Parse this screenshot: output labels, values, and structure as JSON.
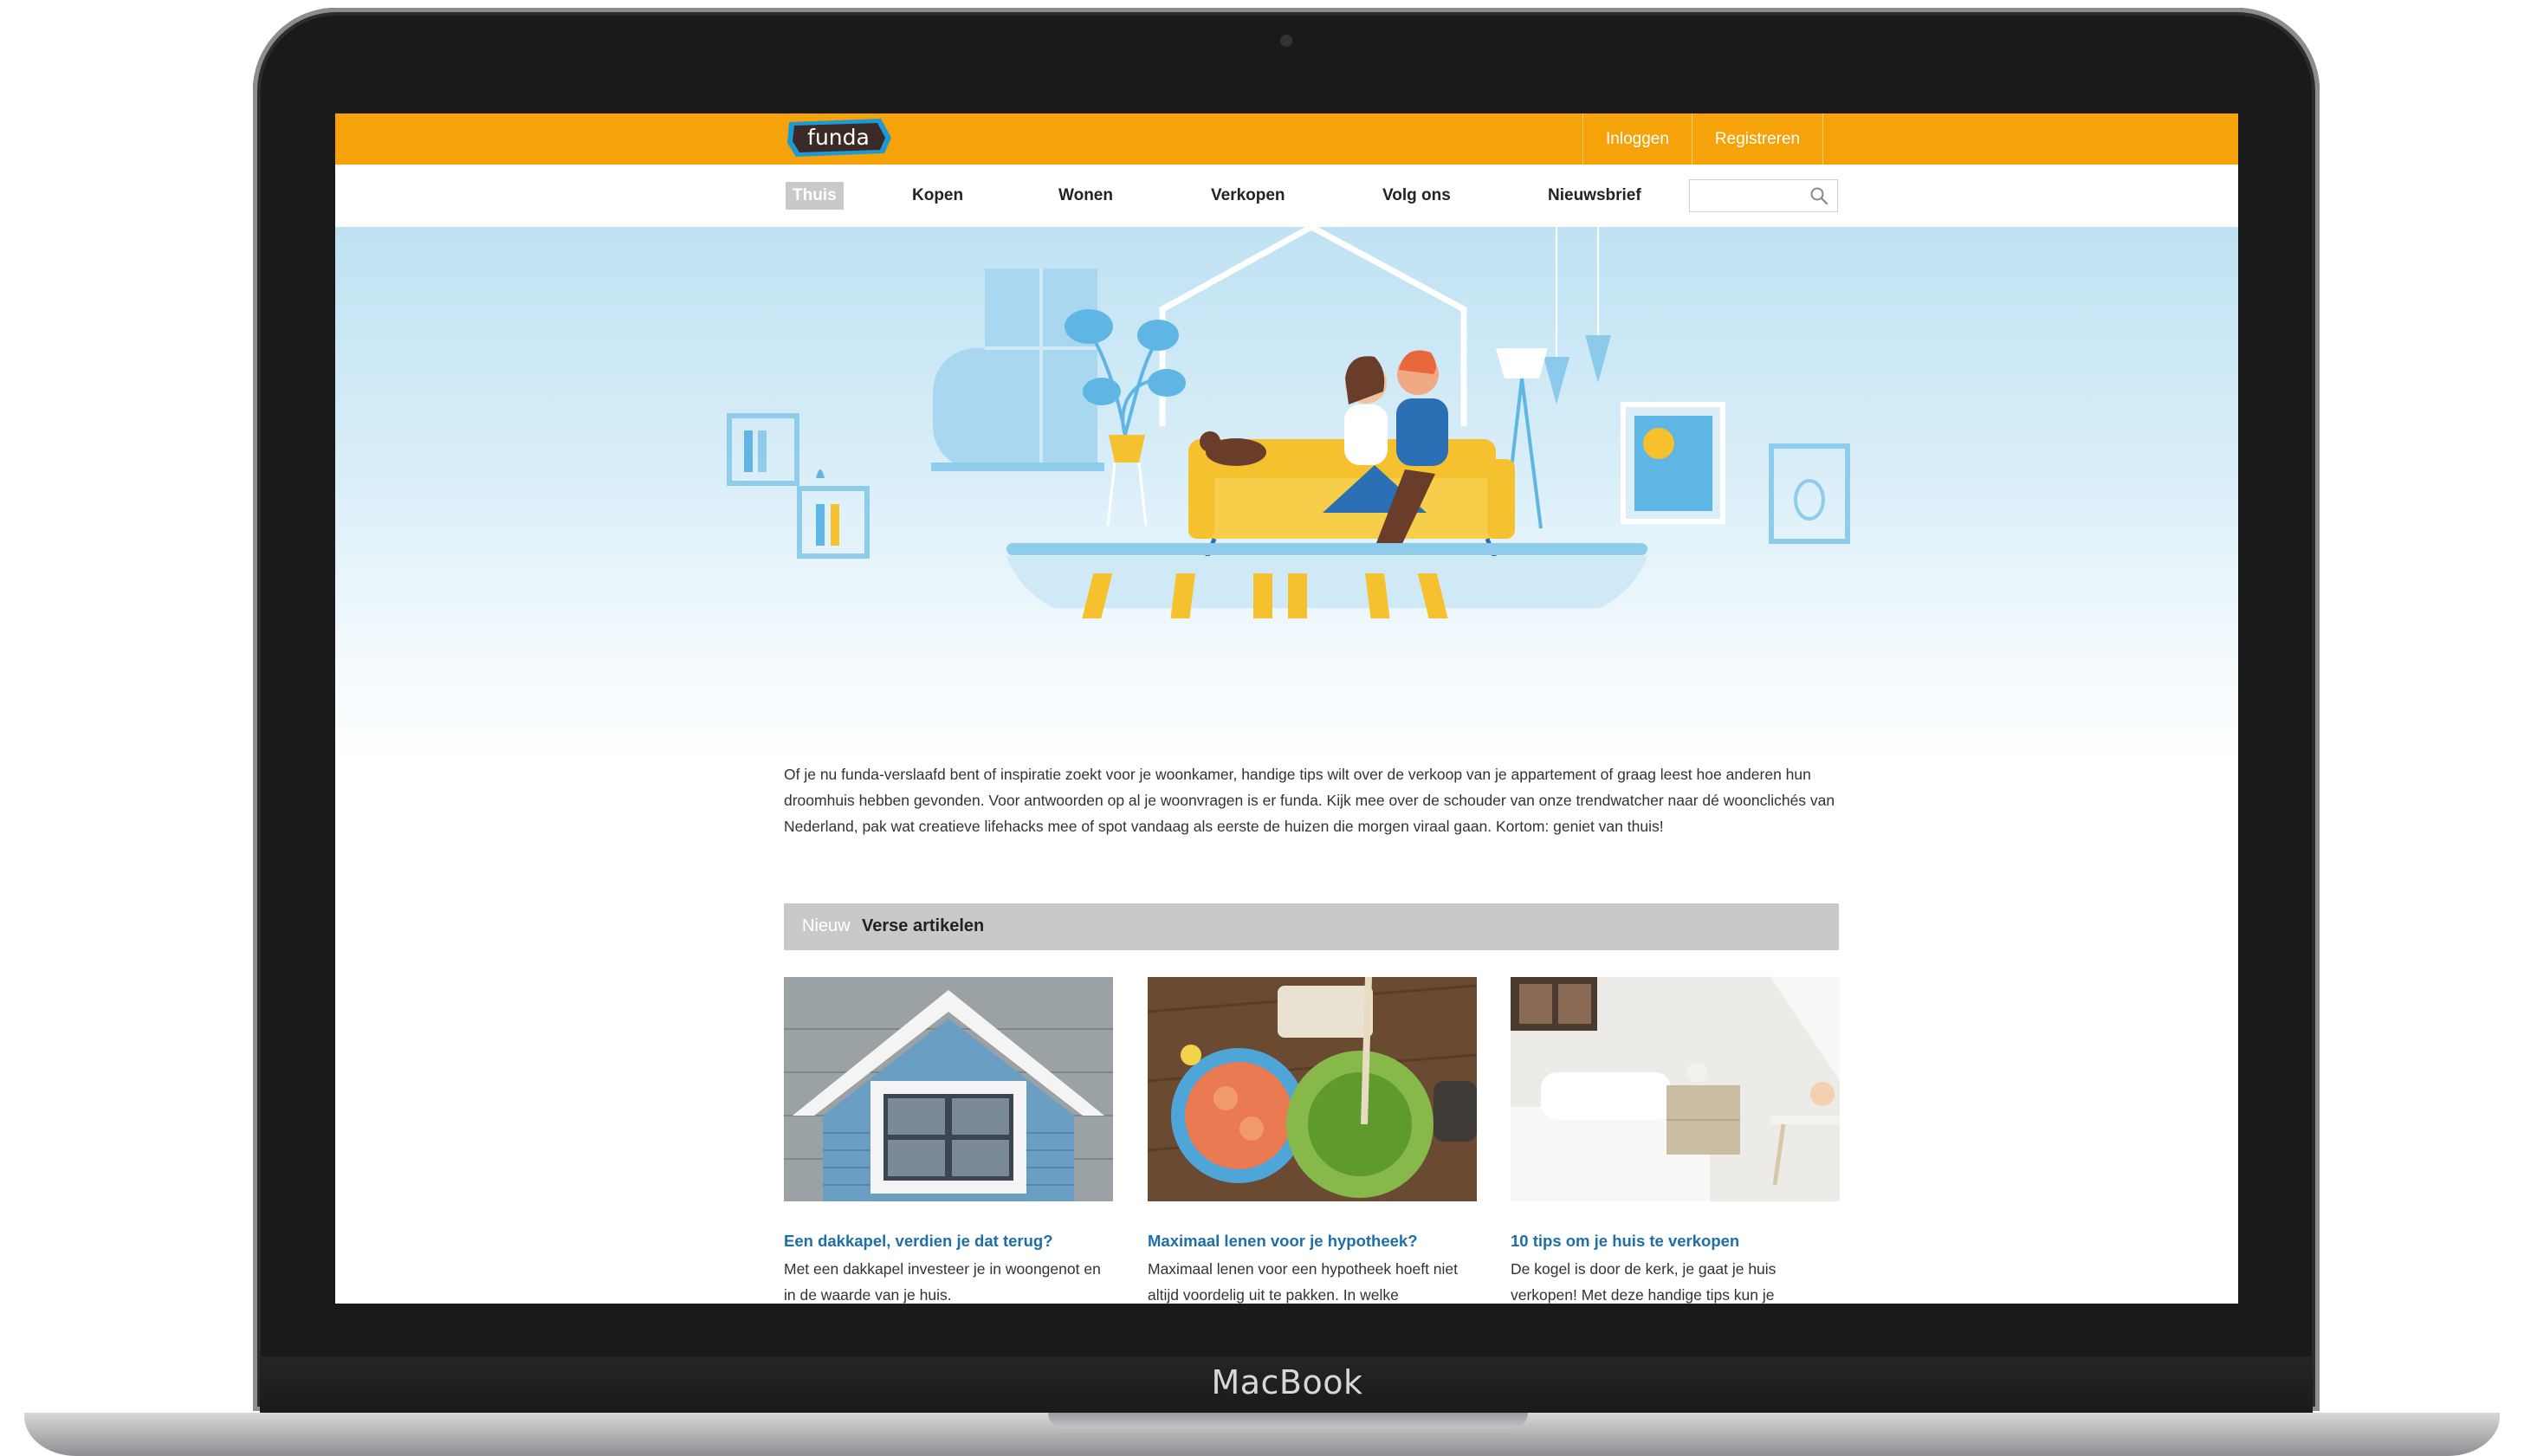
{
  "device": {
    "brand_label": "MacBook"
  },
  "header": {
    "logo_text": "funda",
    "links": {
      "login": "Inloggen",
      "register": "Registreren"
    },
    "accent_color": "#f6a30b"
  },
  "nav": {
    "items": [
      "Thuis",
      "Kopen",
      "Wonen",
      "Verkopen",
      "Volg ons",
      "Nieuwsbrief"
    ],
    "active": "Thuis",
    "search": {
      "value": "",
      "placeholder": ""
    }
  },
  "intro": {
    "text": "Of je nu funda-verslaafd bent of inspiratie zoekt voor je woonkamer, handige tips wilt over de verkoop van je appartement of graag leest hoe anderen hun droomhuis hebben gevonden. Voor antwoorden op al je woonvragen is er funda. Kijk mee over de schouder van onze trendwatcher naar dé woonclichés van Nederland, pak wat creatieve lifehacks mee of spot vandaag als eerste de huizen die morgen viraal gaan. Kortom: geniet van thuis!"
  },
  "section": {
    "tag": "Nieuw",
    "title": "Verse artikelen"
  },
  "articles": [
    {
      "title": "Een dakkapel, verdien je dat terug?",
      "excerpt": "Met een dakkapel investeer je in woongenot en in de waarde van je huis."
    },
    {
      "title": "Maximaal lenen voor je hypotheek?",
      "excerpt": "Maximaal lenen voor een hypotheek hoeft niet altijd voordelig uit te pakken. In welke"
    },
    {
      "title": "10 tips om je huis te verkopen",
      "excerpt": "De kogel is door de kerk, je gaat je huis verkopen! Met deze handige tips kun je"
    }
  ]
}
